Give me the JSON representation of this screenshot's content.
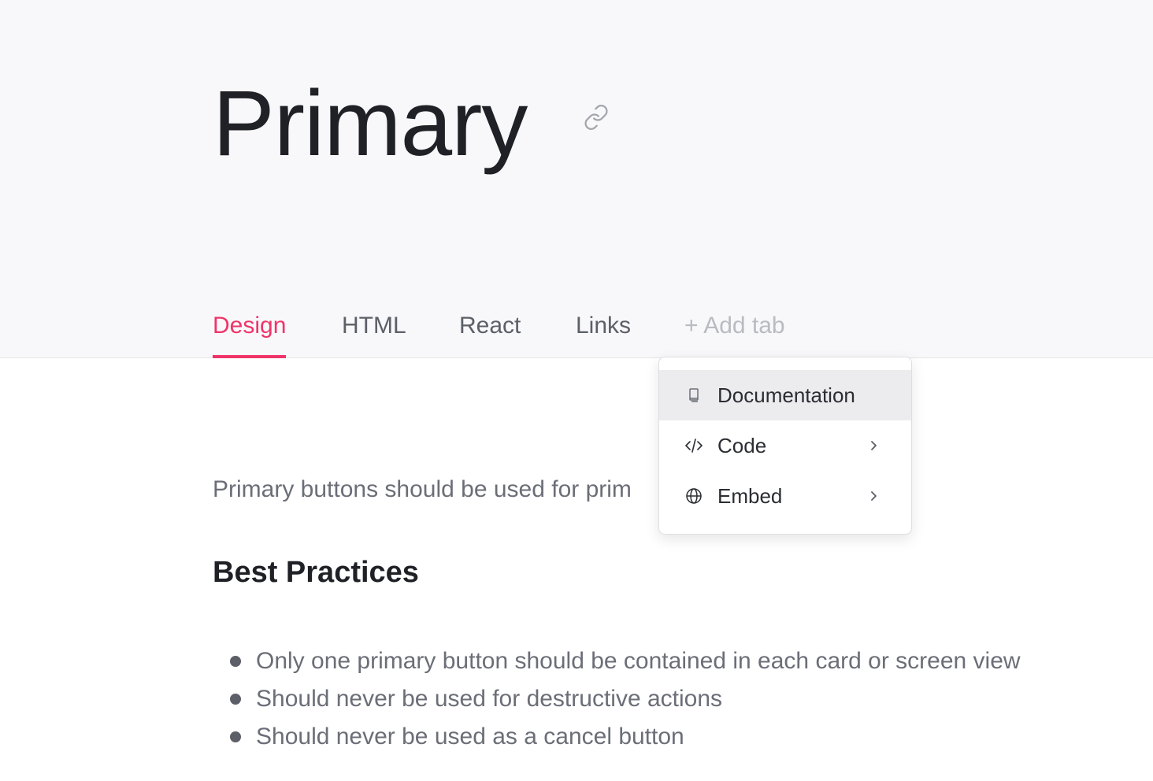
{
  "page": {
    "title": "Primary",
    "intro_text": "Primary buttons should be used for prim"
  },
  "tabs": [
    {
      "label": "Design",
      "active": true
    },
    {
      "label": "HTML",
      "active": false
    },
    {
      "label": "React",
      "active": false
    },
    {
      "label": "Links",
      "active": false
    }
  ],
  "add_tab_label": "+ Add tab",
  "menu": {
    "items": [
      {
        "label": "Documentation",
        "icon": "book-icon",
        "has_submenu": false,
        "highlighted": true
      },
      {
        "label": "Code",
        "icon": "code-icon",
        "has_submenu": true,
        "highlighted": false
      },
      {
        "label": "Embed",
        "icon": "globe-icon",
        "has_submenu": true,
        "highlighted": false
      }
    ]
  },
  "best_practices": {
    "title": "Best Practices",
    "items": [
      "Only one primary button should be contained in each card or screen view",
      "Should never be used for destructive actions",
      "Should never be used as a cancel button"
    ]
  },
  "colors": {
    "accent": "#f03469",
    "header_bg": "#f8f8fa",
    "text_dark": "#1f2126",
    "text_muted": "#6b6e77"
  }
}
